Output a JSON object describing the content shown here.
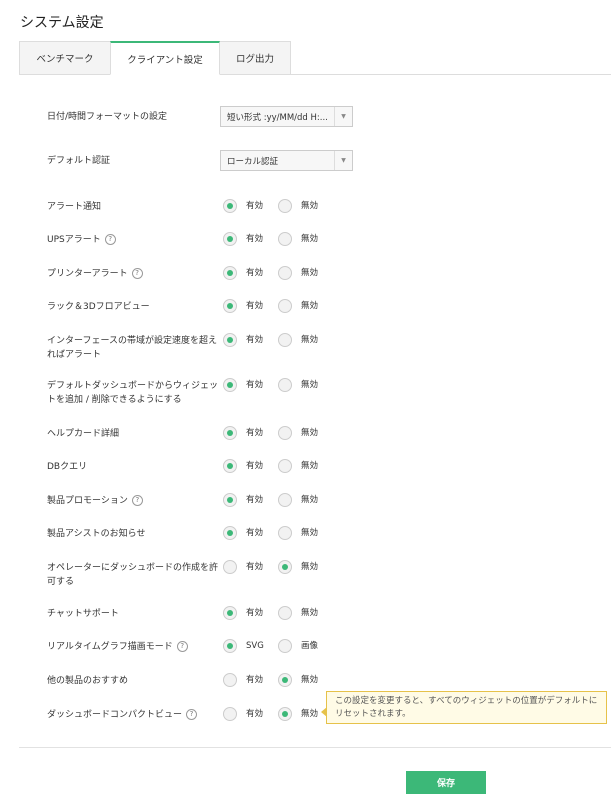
{
  "page": {
    "title": "システム設定"
  },
  "tabs": [
    {
      "label": "ベンチマーク",
      "active": false
    },
    {
      "label": "クライアント設定",
      "active": true
    },
    {
      "label": "ログ出力",
      "active": false
    }
  ],
  "settings": {
    "date_format": {
      "label": "日付/時間フォーマットの設定",
      "value": "短い形式 :yy/MM/dd H:..."
    },
    "default_auth": {
      "label": "デフォルト認証",
      "value": "ローカル認証"
    }
  },
  "toggles": [
    {
      "label": "アラート通知",
      "help": false,
      "on": "有効",
      "off": "無効",
      "selected": "on"
    },
    {
      "label": "UPSアラート",
      "help": true,
      "on": "有効",
      "off": "無効",
      "selected": "on"
    },
    {
      "label": "プリンターアラート",
      "help": true,
      "on": "有効",
      "off": "無効",
      "selected": "on"
    },
    {
      "label": "ラック＆3Dフロアビュー",
      "help": false,
      "on": "有効",
      "off": "無効",
      "selected": "on"
    },
    {
      "label": "インターフェースの帯域が設定速度を超えればアラート",
      "help": false,
      "on": "有効",
      "off": "無効",
      "selected": "on"
    },
    {
      "label": "デフォルトダッシュボードからウィジェットを追加 / 削除できるようにする",
      "help": false,
      "on": "有効",
      "off": "無効",
      "selected": "on"
    },
    {
      "label": "ヘルプカード詳細",
      "help": false,
      "on": "有効",
      "off": "無効",
      "selected": "on"
    },
    {
      "label": "DBクエリ",
      "help": false,
      "on": "有効",
      "off": "無効",
      "selected": "on"
    },
    {
      "label": "製品プロモーション",
      "help": true,
      "on": "有効",
      "off": "無効",
      "selected": "on"
    },
    {
      "label": "製品アシストのお知らせ",
      "help": false,
      "on": "有効",
      "off": "無効",
      "selected": "on"
    },
    {
      "label": "オペレーターにダッシュボードの作成を許可する",
      "help": false,
      "on": "有効",
      "off": "無効",
      "selected": "off"
    },
    {
      "label": "チャットサポート",
      "help": false,
      "on": "有効",
      "off": "無効",
      "selected": "on"
    },
    {
      "label": "リアルタイムグラフ描画モード",
      "help": true,
      "on": "SVG",
      "off": "画像",
      "selected": "on"
    },
    {
      "label": "他の製品のおすすめ",
      "help": false,
      "on": "有効",
      "off": "無効",
      "selected": "off"
    },
    {
      "label": "ダッシュボードコンパクトビュー",
      "help": true,
      "on": "有効",
      "off": "無効",
      "selected": "off"
    }
  ],
  "tooltip": {
    "text": "この設定を変更すると、すべてのウィジェットの位置がデフォルトにリセットされます。"
  },
  "help_glyph": "?",
  "footer": {
    "save_label": "保存"
  },
  "colors": {
    "accent": "#3cb878",
    "tooltip_bg": "#fffbe6",
    "tooltip_border": "#e6c24a"
  }
}
